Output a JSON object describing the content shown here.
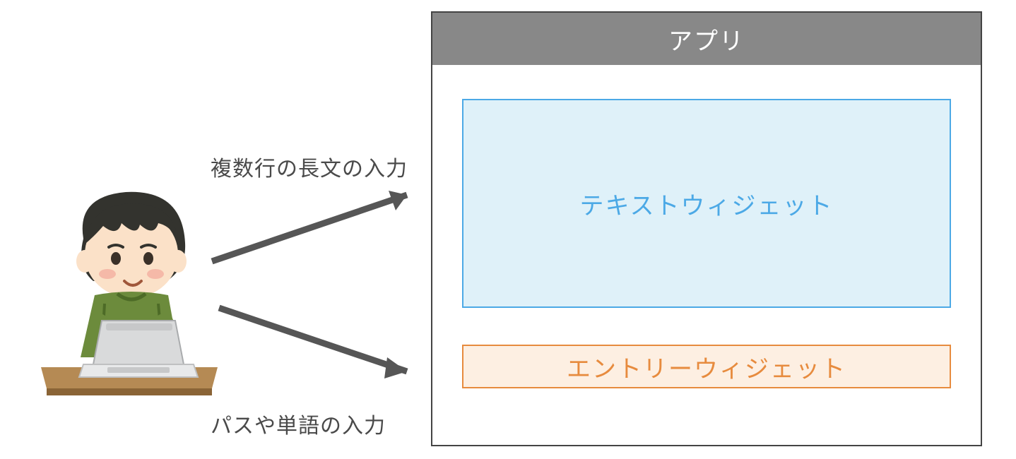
{
  "app": {
    "title": "アプリ",
    "text_widget_label": "テキストウィジェット",
    "entry_widget_label": "エントリーウィジェット"
  },
  "annotations": {
    "multiline_input": "複数行の長文の入力",
    "singleline_input": "パスや単語の入力"
  },
  "icons": {
    "user_at_laptop": "user-at-laptop-icon",
    "arrow": "arrow-icon"
  },
  "colors": {
    "titlebar_bg": "#888888",
    "titlebar_text": "#ffffff",
    "window_border": "#444444",
    "text_widget_bg": "#dff1f9",
    "text_widget_border": "#4ca9e6",
    "text_widget_text": "#4ca9e6",
    "entry_widget_bg": "#fdefe2",
    "entry_widget_border": "#e78b3e",
    "entry_widget_text": "#e78b3e",
    "arrow": "#565656",
    "label_text": "#4a4a4a"
  }
}
